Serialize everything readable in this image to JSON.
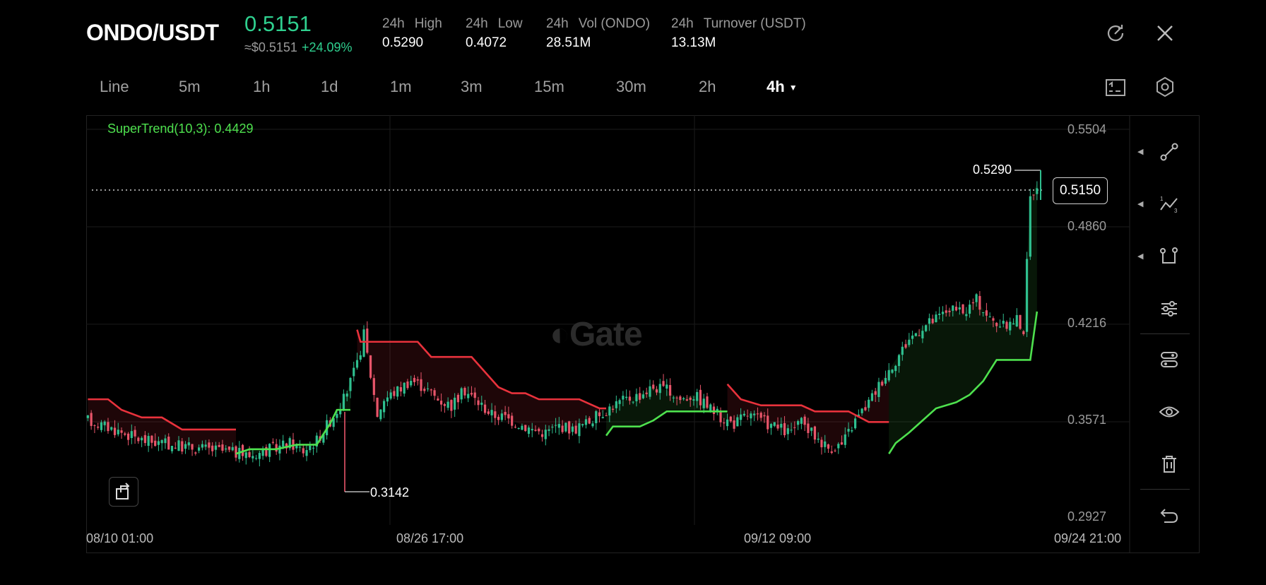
{
  "header": {
    "pair": "ONDO/USDT",
    "last_price": "0.5151",
    "approx_usd": "≈$0.5151",
    "change_pct": "+24.09%",
    "stats": [
      {
        "label_a": "24h",
        "label_b": "High",
        "value": "0.5290"
      },
      {
        "label_a": "24h",
        "label_b": "Low",
        "value": "0.4072"
      },
      {
        "label_a": "24h",
        "label_b": "Vol (ONDO)",
        "value": "28.51M"
      },
      {
        "label_a": "24h",
        "label_b": "Turnover (USDT)",
        "value": "13.13M"
      }
    ],
    "icons": {
      "refresh": "refresh-icon",
      "close": "close-icon"
    }
  },
  "timeframes": [
    "Line",
    "5m",
    "1h",
    "1d",
    "1m",
    "3m",
    "15m",
    "30m",
    "2h",
    "4h"
  ],
  "active_timeframe": "4h",
  "toolbar_icons": {
    "indicator_toggle": "indicator-panel-icon",
    "settings": "settings-hex-icon"
  },
  "chart": {
    "indicator_label": "SuperTrend(10,3): 0.4429",
    "watermark": "Gate",
    "current_price_badge": "0.5150",
    "high_marker": "0.5290",
    "low_marker": "0.3142",
    "colors": {
      "up": "#2fbf8f",
      "down": "#e8556a",
      "supertrend_up": "#4ee14e",
      "supertrend_down": "#e8323c"
    }
  },
  "chart_data": {
    "type": "candlestick",
    "pair": "ONDO/USDT",
    "interval": "4h",
    "y_ticks": [
      "0.5504",
      "0.4860",
      "0.4216",
      "0.3571",
      "0.2927"
    ],
    "x_ticks": [
      "08/10 01:00",
      "08/26 17:00",
      "09/12 09:00",
      "09/24 21:00"
    ],
    "ylim": [
      0.2927,
      0.5504
    ],
    "close_path": [
      [
        0,
        0.358
      ],
      [
        8,
        0.352
      ],
      [
        16,
        0.345
      ],
      [
        24,
        0.342
      ],
      [
        32,
        0.34
      ],
      [
        40,
        0.338
      ],
      [
        48,
        0.335
      ],
      [
        56,
        0.34
      ],
      [
        60,
        0.343
      ],
      [
        64,
        0.338
      ],
      [
        68,
        0.345
      ],
      [
        72,
        0.358
      ],
      [
        76,
        0.372
      ],
      [
        80,
        0.395
      ],
      [
        82,
        0.415
      ],
      [
        84,
        0.388
      ],
      [
        86,
        0.362
      ],
      [
        88,
        0.372
      ],
      [
        92,
        0.378
      ],
      [
        96,
        0.385
      ],
      [
        100,
        0.38
      ],
      [
        104,
        0.372
      ],
      [
        108,
        0.368
      ],
      [
        112,
        0.378
      ],
      [
        116,
        0.37
      ],
      [
        120,
        0.362
      ],
      [
        124,
        0.36
      ],
      [
        128,
        0.356
      ],
      [
        132,
        0.352
      ],
      [
        136,
        0.35
      ],
      [
        140,
        0.355
      ],
      [
        144,
        0.352
      ],
      [
        148,
        0.356
      ],
      [
        152,
        0.362
      ],
      [
        156,
        0.368
      ],
      [
        160,
        0.372
      ],
      [
        164,
        0.375
      ],
      [
        168,
        0.38
      ],
      [
        172,
        0.378
      ],
      [
        176,
        0.372
      ],
      [
        180,
        0.375
      ],
      [
        184,
        0.368
      ],
      [
        188,
        0.36
      ],
      [
        192,
        0.356
      ],
      [
        196,
        0.362
      ],
      [
        200,
        0.358
      ],
      [
        204,
        0.354
      ],
      [
        208,
        0.35
      ],
      [
        212,
        0.356
      ],
      [
        216,
        0.348
      ],
      [
        220,
        0.34
      ],
      [
        224,
        0.342
      ],
      [
        228,
        0.358
      ],
      [
        232,
        0.37
      ],
      [
        236,
        0.385
      ],
      [
        240,
        0.398
      ],
      [
        244,
        0.412
      ],
      [
        248,
        0.42
      ],
      [
        252,
        0.425
      ],
      [
        256,
        0.432
      ],
      [
        260,
        0.428
      ],
      [
        264,
        0.438
      ],
      [
        268,
        0.425
      ],
      [
        272,
        0.42
      ],
      [
        276,
        0.425
      ],
      [
        278,
        0.418
      ],
      [
        280,
        0.505
      ],
      [
        282,
        0.515
      ]
    ],
    "supertrend_segments": [
      {
        "direction": "down",
        "points": [
          [
            0,
            0.372
          ],
          [
            6,
            0.372
          ],
          [
            10,
            0.365
          ],
          [
            16,
            0.36
          ],
          [
            22,
            0.36
          ],
          [
            28,
            0.352
          ],
          [
            44,
            0.352
          ]
        ]
      },
      {
        "direction": "up",
        "points": [
          [
            44,
            0.336
          ],
          [
            48,
            0.339
          ],
          [
            56,
            0.339
          ],
          [
            62,
            0.342
          ],
          [
            68,
            0.342
          ],
          [
            72,
            0.356
          ],
          [
            74,
            0.365
          ],
          [
            78,
            0.365
          ]
        ]
      },
      {
        "direction": "down",
        "points": [
          [
            80,
            0.418
          ],
          [
            81,
            0.41
          ],
          [
            98,
            0.41
          ],
          [
            102,
            0.4
          ],
          [
            114,
            0.4
          ],
          [
            118,
            0.39
          ],
          [
            122,
            0.38
          ],
          [
            126,
            0.376
          ],
          [
            130,
            0.376
          ],
          [
            134,
            0.372
          ],
          [
            146,
            0.372
          ],
          [
            152,
            0.366
          ],
          [
            154,
            0.366
          ]
        ]
      },
      {
        "direction": "up",
        "points": [
          [
            154,
            0.348
          ],
          [
            156,
            0.354
          ],
          [
            164,
            0.354
          ],
          [
            168,
            0.358
          ],
          [
            172,
            0.364
          ],
          [
            190,
            0.364
          ]
        ]
      },
      {
        "direction": "down",
        "points": [
          [
            190,
            0.382
          ],
          [
            194,
            0.372
          ],
          [
            200,
            0.368
          ],
          [
            212,
            0.368
          ],
          [
            216,
            0.364
          ],
          [
            226,
            0.364
          ],
          [
            232,
            0.357
          ],
          [
            238,
            0.357
          ]
        ]
      },
      {
        "direction": "up",
        "points": [
          [
            238,
            0.336
          ],
          [
            240,
            0.343
          ],
          [
            244,
            0.35
          ],
          [
            248,
            0.358
          ],
          [
            252,
            0.366
          ],
          [
            258,
            0.37
          ],
          [
            262,
            0.375
          ],
          [
            266,
            0.384
          ],
          [
            270,
            0.398
          ],
          [
            276,
            0.398
          ],
          [
            280,
            0.398
          ],
          [
            282,
            0.43
          ]
        ]
      }
    ]
  },
  "side_tools": [
    "trend-line-icon",
    "fib-icon",
    "shape-icon",
    "indicator-settings-icon",
    "template-icon",
    "visibility-eye-icon",
    "delete-trash-icon",
    "undo-icon"
  ],
  "share_icon": "share-icon"
}
